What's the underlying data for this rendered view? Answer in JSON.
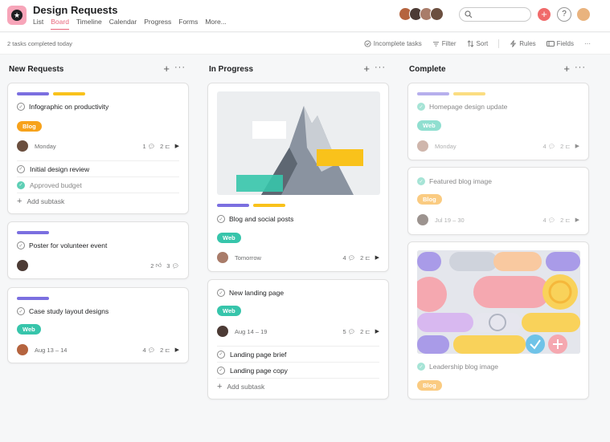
{
  "header": {
    "title": "Design Requests",
    "tabs": [
      "List",
      "Board",
      "Timeline",
      "Calendar",
      "Progress",
      "Forms",
      "More..."
    ],
    "active_tab": "Board",
    "help_label": "?",
    "add_label": "+"
  },
  "toolbar": {
    "completed_text": "2 tasks completed today",
    "incomplete_label": "Incomplete tasks",
    "filter_label": "Filter",
    "sort_label": "Sort",
    "rules_label": "Rules",
    "fields_label": "Fields"
  },
  "colors": {
    "accent": "#f06a6a",
    "purple": "#7b6fe0",
    "yellow": "#f9c21b",
    "blog": "#f7a21b",
    "web": "#37c5ab"
  },
  "columns": [
    {
      "title": "New Requests",
      "cards": [
        {
          "title": "Infographic on productivity",
          "tag": "Blog",
          "date": "Monday",
          "comments": "1",
          "subtasks": "2",
          "subtask_items": [
            "Initial design review",
            "Approved budget"
          ],
          "add_subtask": "Add subtask"
        },
        {
          "title": "Poster for volunteer event",
          "likes": "2",
          "comments": "3"
        },
        {
          "title": "Case study layout designs",
          "tag": "Web",
          "date": "Aug 13 – 14",
          "comments": "4",
          "subtasks": "2"
        }
      ]
    },
    {
      "title": "In Progress",
      "cards": [
        {
          "title": "Blog and social posts",
          "tag": "Web",
          "date": "Tomorrow",
          "comments": "4",
          "subtasks": "2"
        },
        {
          "title": "New landing page",
          "tag": "Web",
          "date": "Aug 14 – 19",
          "comments": "5",
          "subtasks": "2",
          "subtask_items": [
            "Landing page brief",
            "Landing page copy"
          ],
          "add_subtask": "Add subtask"
        }
      ]
    },
    {
      "title": "Complete",
      "cards": [
        {
          "title": "Homepage design update",
          "tag": "Web",
          "date": "Monday",
          "comments": "4",
          "subtasks": "2"
        },
        {
          "title": "Featured blog image",
          "tag": "Blog",
          "date": "Jul 19 – 30",
          "comments": "4",
          "subtasks": "2"
        },
        {
          "title": "Leadership blog image",
          "tag": "Blog"
        }
      ]
    }
  ]
}
